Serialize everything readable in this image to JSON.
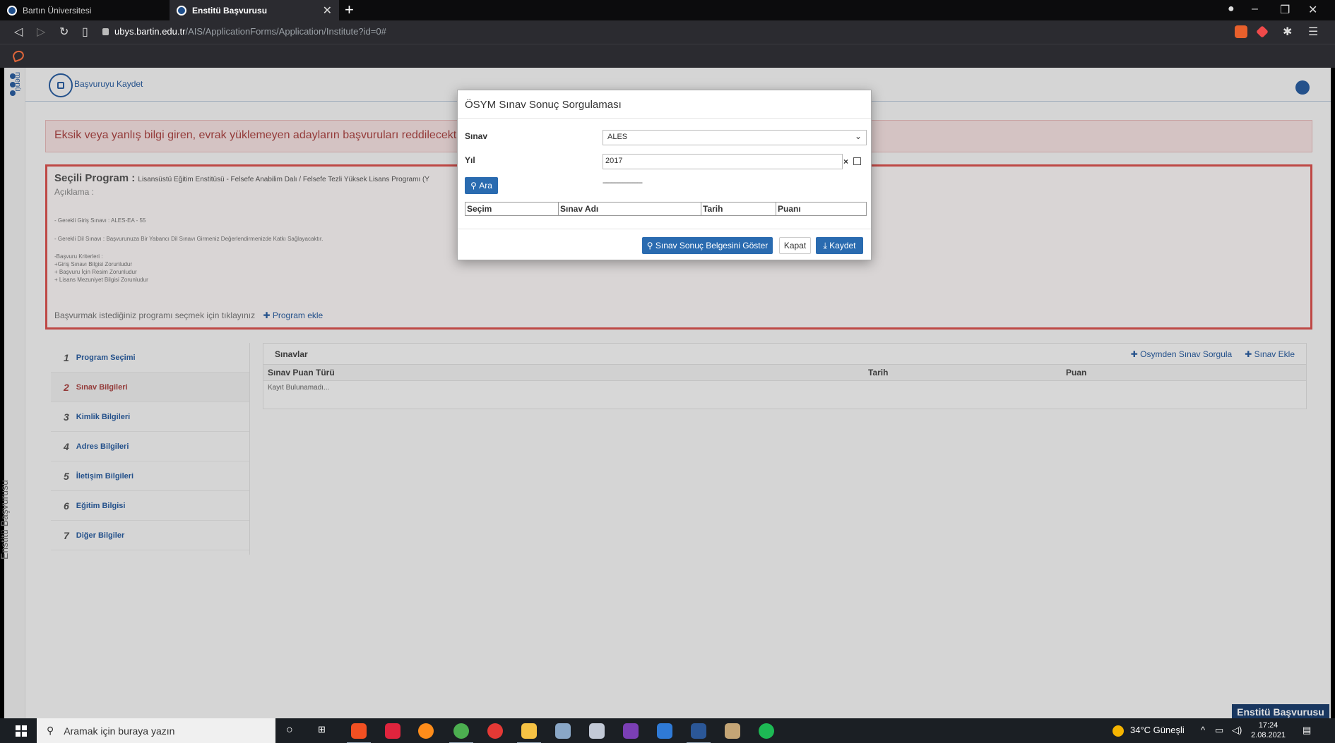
{
  "browser": {
    "tabs": [
      {
        "label": "Bartın Üniversitesi"
      },
      {
        "label": "Enstitü Başvurusu"
      }
    ],
    "url_host": "ubys.bartin.edu.tr",
    "url_path": "/AIS/ApplicationForms/Application/Institute?id=0#"
  },
  "page": {
    "menu_label": "menü",
    "save_label": "Başvuruyu Kaydet",
    "alert": "Eksik veya yanlış bilgi giren, evrak yüklemeyen adayların başvuruları reddilecektir.",
    "program": {
      "title": "Seçili Program :",
      "name": "Lisansüstü Eğitim Enstitüsü - Felsefe Anabilim Dalı / Felsefe Tezli Yüksek Lisans Programı (Y",
      "desc_label": "Açıklama :",
      "lines": [
        "- Gerekli Giriş Sınavı : ALES-EA - 55",
        "- Gerekli Dil Sınavı : Başvurunuza Bir Yabancı Dil Sınavı Girmeniz Değerlendirmenizde Katkı Sağlayacaktır.",
        "-Başvuru Kriterleri :",
        "+Giriş Sınavı Bilgisi Zorunludur",
        "+ Başvuru İçin Resim Zorunludur",
        "+ Lisans Mezuniyet Bilgisi Zorunludur"
      ],
      "footer_text": "Başvurmak istediğiniz programı seçmek için tıklayınız",
      "add_program": "Program ekle"
    },
    "steps": [
      {
        "num": "1",
        "label": "Program Seçimi"
      },
      {
        "num": "2",
        "label": "Sınav Bilgileri"
      },
      {
        "num": "3",
        "label": "Kimlik Bilgileri"
      },
      {
        "num": "4",
        "label": "Adres Bilgileri"
      },
      {
        "num": "5",
        "label": "İletişim Bilgileri"
      },
      {
        "num": "6",
        "label": "Eğitim Bilgisi"
      },
      {
        "num": "7",
        "label": "Diğer Bilgiler"
      }
    ],
    "exams": {
      "title": "Sınavlar",
      "action_query": "Osymden Sınav Sorgula",
      "action_add": "Sınav Ekle",
      "columns": [
        "Sınav Puan Türü",
        "Tarih",
        "Puan"
      ],
      "empty": "Kayıt Bulunamadı..."
    },
    "rail_label": "Enstitü Başvurusu",
    "bottom_tag": "Enstitü Başvurusu"
  },
  "modal": {
    "title": "ÖSYM Sınav Sonuç Sorgulaması",
    "exam_label": "Sınav",
    "exam_value": "ALES",
    "year_label": "Yıl",
    "year_value": "2017",
    "search_button": "Ara",
    "dashes": "------------------------",
    "columns": [
      "Seçim",
      "Sınav Adı",
      "Tarih",
      "Puanı"
    ],
    "show_doc_button": "Sınav Sonuç Belgesini Göster",
    "close_button": "Kapat",
    "save_button": "Kaydet"
  },
  "taskbar": {
    "search_placeholder": "Aramak için buraya yazın",
    "weather": "34°C Güneşli",
    "time": "17:24",
    "date": "2.08.2021"
  },
  "colors": {
    "accent": "#2a6bb0",
    "danger": "#d9534f",
    "alert_bg": "#f2dede"
  }
}
